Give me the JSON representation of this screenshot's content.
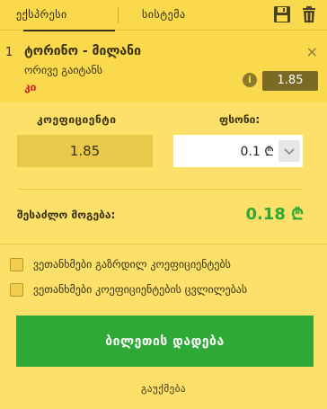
{
  "tabs": [
    {
      "label": "ექსპრესი",
      "active": true
    },
    {
      "label": "სისტემა",
      "active": false
    }
  ],
  "toolbar": {
    "save_icon": "save-icon",
    "delete_icon": "trash-icon"
  },
  "bet": {
    "number": "1",
    "match": "ტორინო - მილანი",
    "market": "ორივე გაიტანს",
    "selection": "კი",
    "odds": "1.85",
    "close_glyph": "×",
    "info_glyph": "i"
  },
  "form": {
    "coefficient_label": "კოეფიციენტი",
    "coefficient_value": "1.85",
    "stake_label": "ფსონი:",
    "stake_value": "0.1 ₾",
    "potential_win_label": "შესაძლო მოგება:",
    "potential_win_value": "0.18 ₾"
  },
  "options": [
    {
      "label": "ვეთანხმები გაზრდილ კოეფიციენტებს",
      "checked": false
    },
    {
      "label": "ვეთანხმები კოეფიციენტების ცვლილებას",
      "checked": false
    }
  ],
  "actions": {
    "place_bet": "ბილეთის დადება",
    "cancel": "გაუქმება"
  },
  "colors": {
    "accent_green": "#2ea836",
    "background": "#fbd94c",
    "selection_red": "#d1202b"
  }
}
